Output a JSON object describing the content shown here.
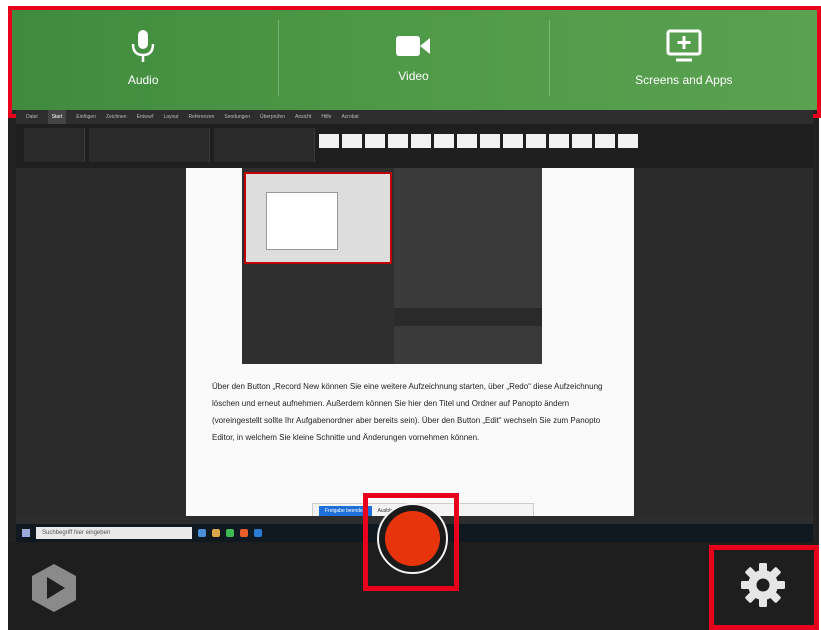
{
  "sources": {
    "audio_label": "Audio",
    "video_label": "Video",
    "screens_label": "Screens and Apps"
  },
  "preview": {
    "doc_text": "Über den Button „Record New können Sie eine weitere Aufzeichnung starten, über „Redo“ diese Aufzeichnung löschen und erneut aufnehmen. Außerdem können Sie hier den Titel und Ordner auf Panopto ändern (voreingestellt sollte Ihr Aufgabenordner aber bereits sein). Über den Button „Edit“ wechseln Sie zum Panopto Editor, in welchem Sie kleine Schnitte und Änderungen vornehmen können.",
    "ribbon_tabs": [
      "Datei",
      "Start",
      "Einfügen",
      "Zeichnen",
      "Entwurf",
      "Layout",
      "Referenzen",
      "Sendungen",
      "Überprüfen",
      "Ansicht",
      "Hilfe",
      "Acrobat"
    ],
    "taskbar_search": "Suchbegriff hier eingeben",
    "notify_button": "Freigabe beenden",
    "notify_link": "Ausblenden"
  },
  "colors": {
    "accent_green": "#4f9a48",
    "record_red": "#e8340c",
    "highlight_red": "#e8001c"
  },
  "icons": {
    "audio": "microphone-icon",
    "video": "video-camera-icon",
    "screens": "monitor-plus-icon",
    "logo": "panopto-logo",
    "settings": "gear-icon"
  }
}
